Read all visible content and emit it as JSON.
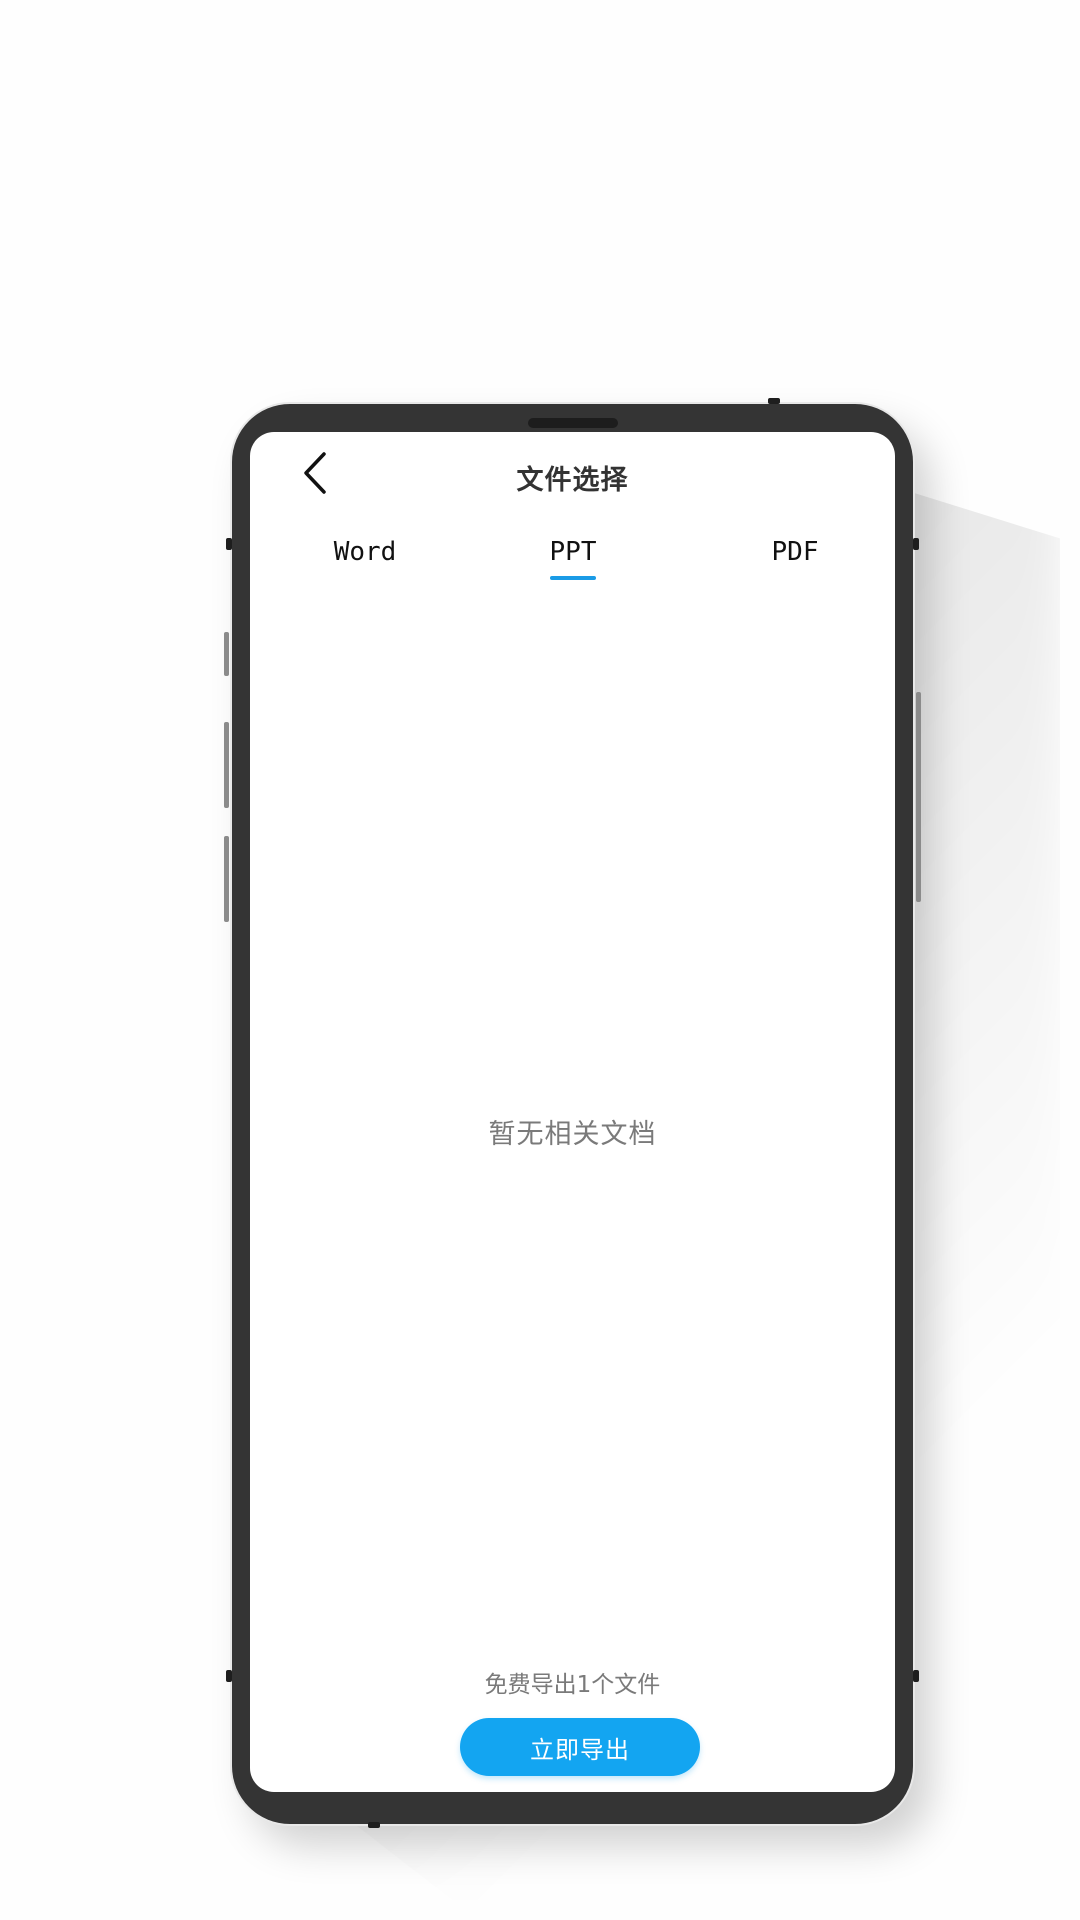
{
  "header": {
    "title": "文件选择"
  },
  "tabs": [
    {
      "label": "Word",
      "active": false
    },
    {
      "label": "PPT",
      "active": true
    },
    {
      "label": "PDF",
      "active": false
    }
  ],
  "empty_state": {
    "message": "暂无相关文档"
  },
  "footer": {
    "free_note": "免费导出1个文件",
    "export_label": "立即导出"
  },
  "icons": {
    "back": "chevron-left-icon"
  },
  "colors": {
    "accent": "#13a5f1",
    "tab_underline": "#1a9be6",
    "device_frame": "#343434",
    "muted_text": "#7a7a7a",
    "title_text": "#333333"
  }
}
